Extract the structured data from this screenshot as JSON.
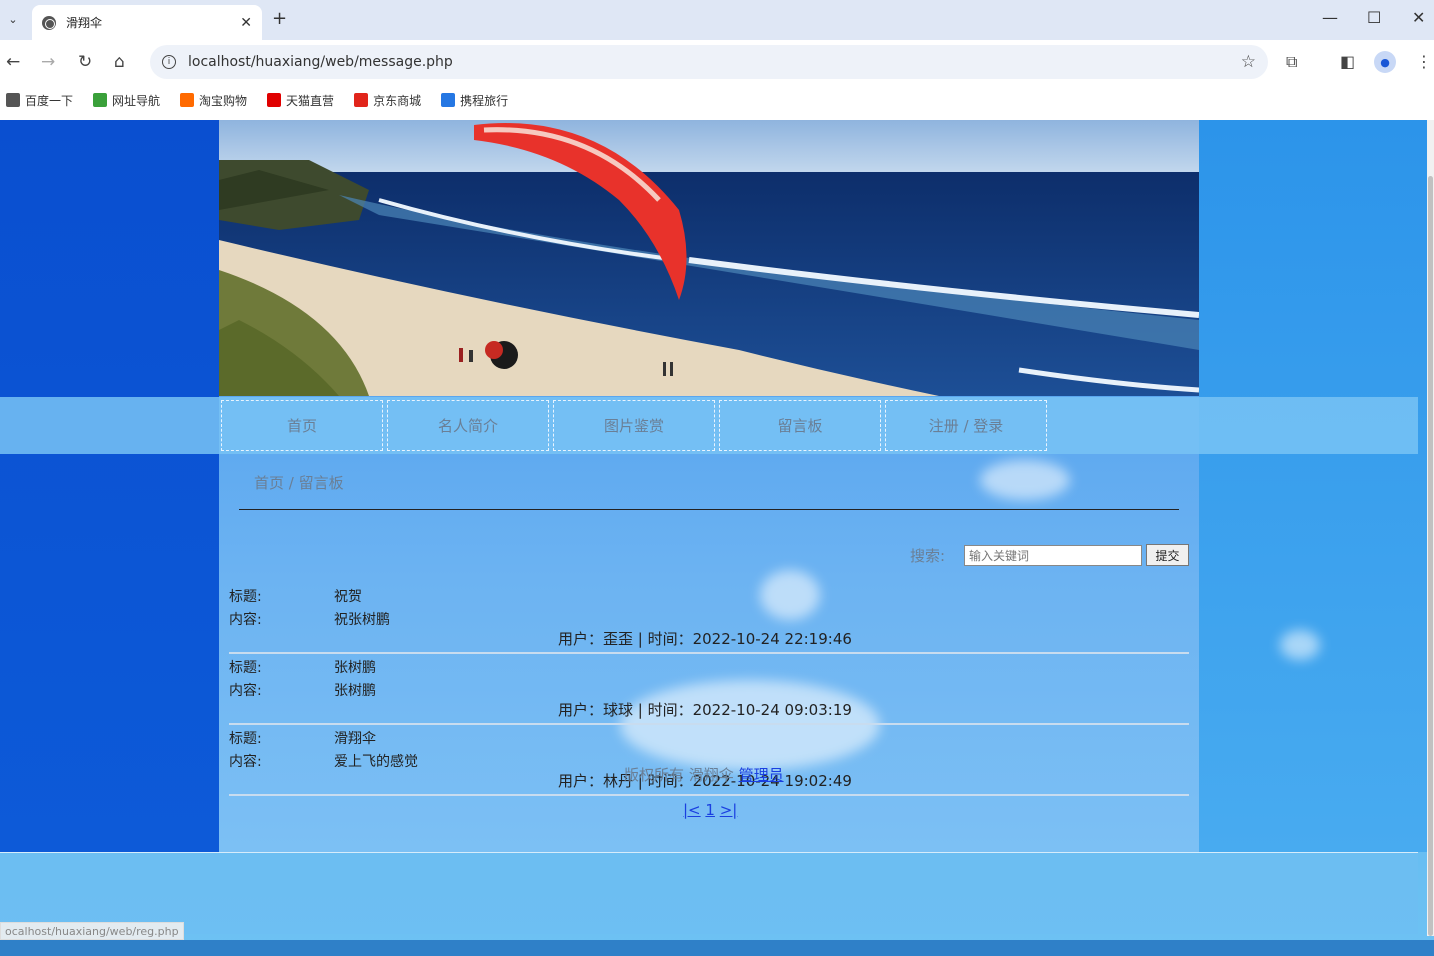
{
  "browser": {
    "tab_title": "滑翔伞",
    "url": "localhost/huaxiang/web/message.php",
    "bookmarks": [
      {
        "label": "百度一下",
        "icon": "globe-icon",
        "color": "#555555"
      },
      {
        "label": "网址导航",
        "icon": "hao123-icon",
        "color": "#3aa03a"
      },
      {
        "label": "淘宝购物",
        "icon": "taobao-icon",
        "color": "#ff6a00"
      },
      {
        "label": "天猫直营",
        "icon": "tmall-icon",
        "color": "#e00000"
      },
      {
        "label": "京东商城",
        "icon": "jd-icon",
        "color": "#e1251b"
      },
      {
        "label": "携程旅行",
        "icon": "ctrip-icon",
        "color": "#2577e3"
      }
    ],
    "status_url": "ocalhost/huaxiang/web/reg.php"
  },
  "nav": {
    "items": [
      "首页",
      "名人简介",
      "图片鉴赏",
      "留言板",
      "注册 / 登录"
    ]
  },
  "breadcrumb": "首页 / 留言板",
  "search": {
    "label": "搜索:",
    "placeholder": "输入关键词",
    "button": "提交"
  },
  "labels": {
    "title": "标题:",
    "content": "内容:"
  },
  "messages": [
    {
      "title": "祝贺",
      "content": "祝张树鹏",
      "meta": "用户：歪歪 | 时间：2022-10-24 22:19:46"
    },
    {
      "title": "张树鹏",
      "content": "张树鹏",
      "meta": "用户：球球 | 时间：2022-10-24 09:03:19"
    },
    {
      "title": "滑翔伞",
      "content": "爱上飞的感觉",
      "meta": "用户：林丹 | 时间：2022-10-24 19:02:49"
    }
  ],
  "pager": {
    "first": "|<",
    "page": "1",
    "last": ">|"
  },
  "footer": {
    "text": "版权所有 滑翔伞",
    "admin_link": "管理员"
  },
  "colors": {
    "link": "#1a3fe0",
    "nav_text": "#6a7f96",
    "left_band": "#0a4fd0"
  }
}
